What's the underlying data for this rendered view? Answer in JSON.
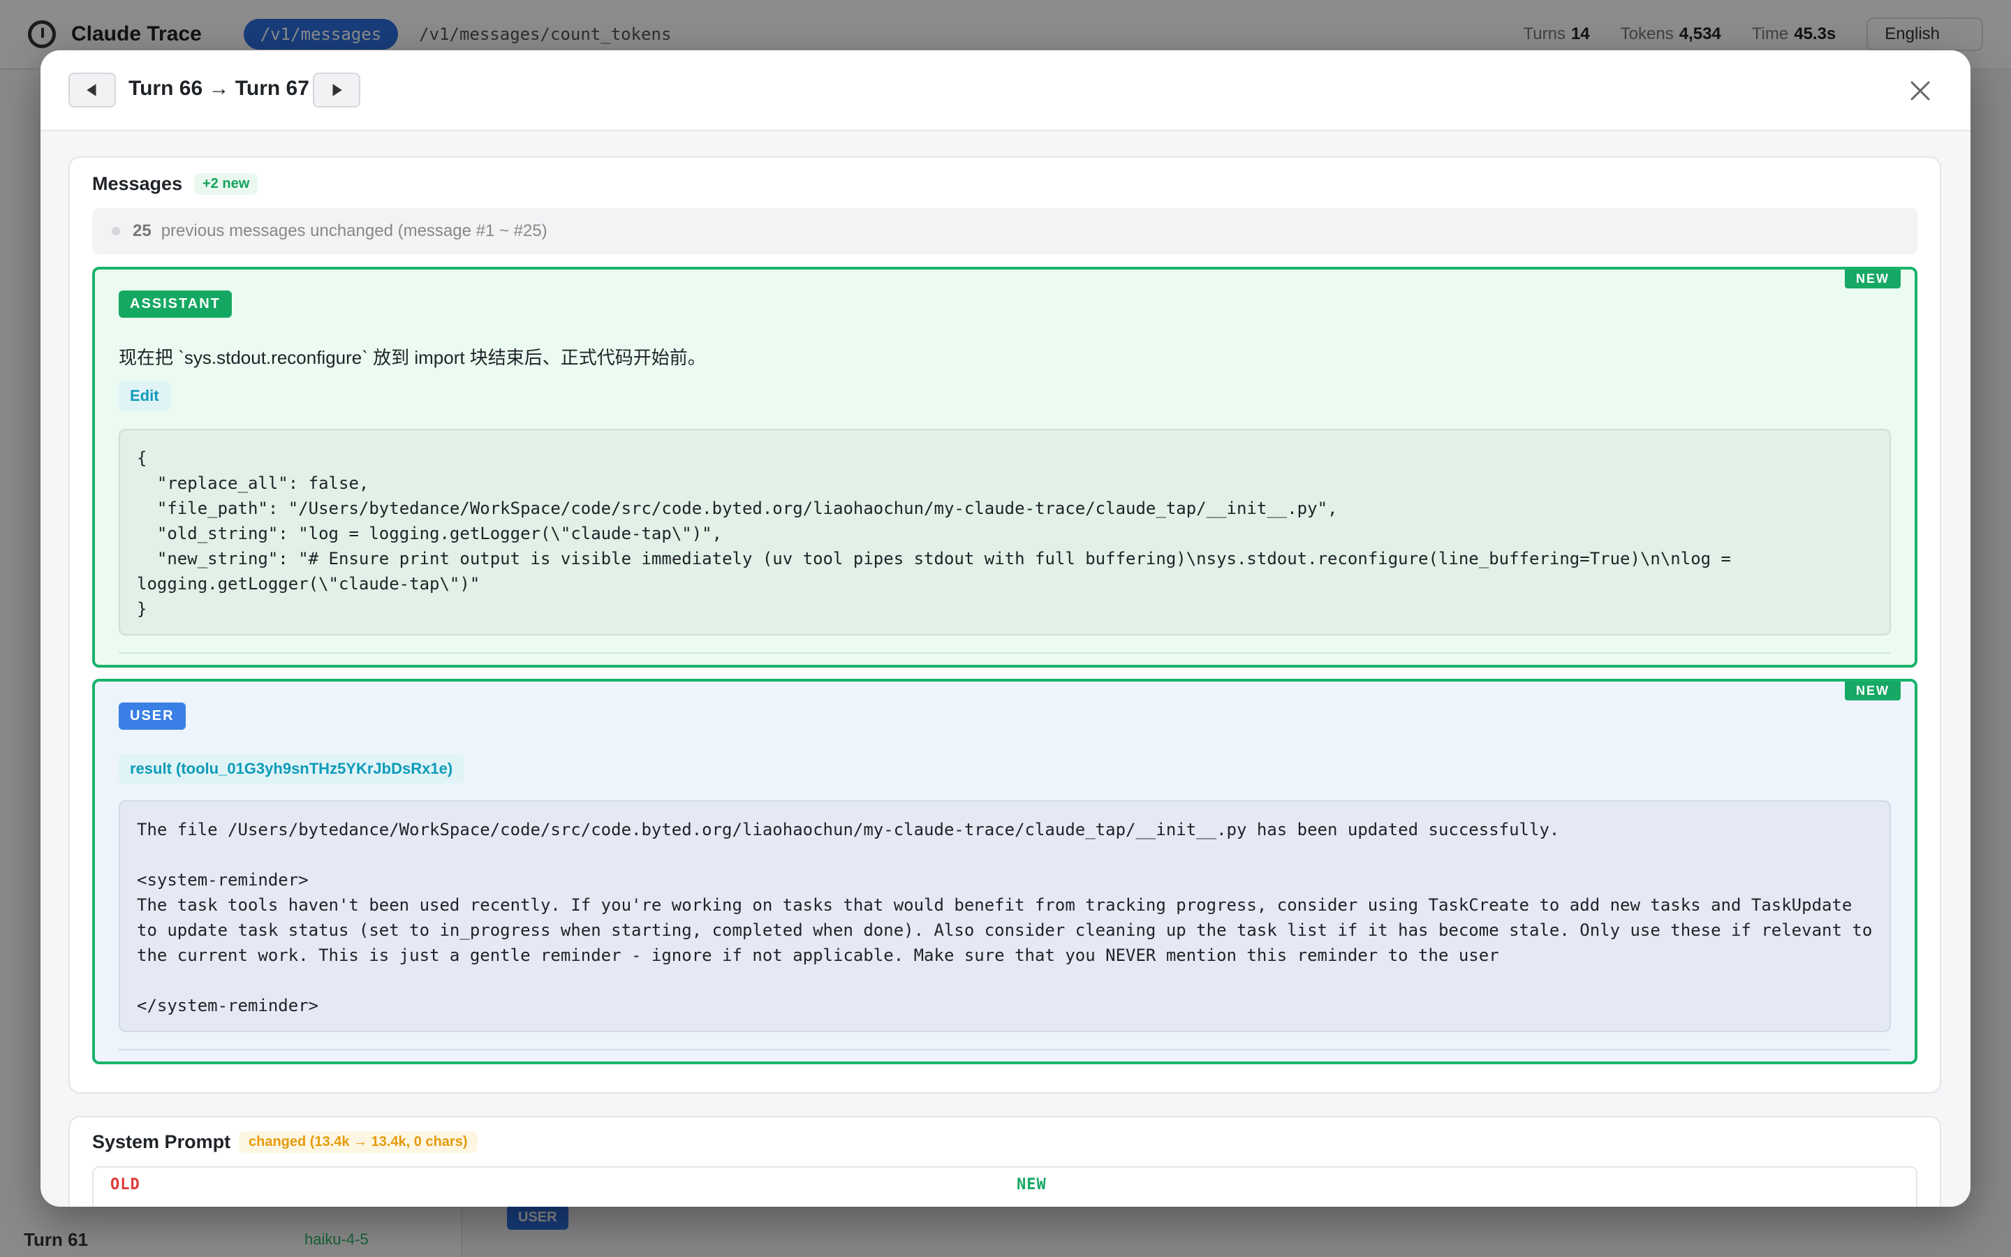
{
  "background": {
    "app_title": "Claude Trace",
    "active_tab": "/v1/messages",
    "tab2": "/v1/messages/count_tokens",
    "stats": {
      "turns_label": "Turns",
      "turns_value": "14",
      "tokens_label": "Tokens",
      "tokens_value": "4,534",
      "time_label": "Time",
      "time_value": "45.3s"
    },
    "language": "English",
    "sidebar_last_item": "Turn 61",
    "sidebar_last_model": "haiku-4-5",
    "bottom_badge": "USER"
  },
  "modal": {
    "title": "Turn 66 → Turn 67",
    "messages": {
      "title": "Messages",
      "new_count": "+2 new",
      "unchanged_count": "25",
      "unchanged_text": "previous messages unchanged (message #1 ~ #25)",
      "items": [
        {
          "role": "ASSISTANT",
          "badge": "NEW",
          "text": "现在把 `sys.stdout.reconfigure` 放到 import 块结束后、正式代码开始前。",
          "tool_label": "Edit",
          "code": "{\n  \"replace_all\": false,\n  \"file_path\": \"/Users/bytedance/WorkSpace/code/src/code.byted.org/liaohaochun/my-claude-trace/claude_tap/__init__.py\",\n  \"old_string\": \"log = logging.getLogger(\\\"claude-tap\\\")\",\n  \"new_string\": \"# Ensure print output is visible immediately (uv tool pipes stdout with full buffering)\\nsys.stdout.reconfigure(line_buffering=True)\\n\\nlog =\nlogging.getLogger(\\\"claude-tap\\\")\"\n}"
        },
        {
          "role": "USER",
          "badge": "NEW",
          "tool_label": "result (toolu_01G3yh9snTHz5YKrJbDsRx1e)",
          "code": "The file /Users/bytedance/WorkSpace/code/src/code.byted.org/liaohaochun/my-claude-trace/claude_tap/__init__.py has been updated successfully.\n\n<system-reminder>\nThe task tools haven't been used recently. If you're working on tasks that would benefit from tracking progress, consider using TaskCreate to add new tasks and TaskUpdate to update task status (set to in_progress when starting, completed when done). Also consider cleaning up the task list if it has become stale. Only use these if relevant to the current work. This is just a gentle reminder - ignore if not applicable. Make sure that you NEVER mention this reminder to the user\n\n</system-reminder>"
        }
      ]
    },
    "system_prompt": {
      "title": "System Prompt",
      "change_badge": "changed (13.4k → 13.4k, 0 chars)",
      "old_label": "OLD",
      "new_label": "NEW"
    }
  },
  "colors": {
    "accent_green": "#19b36b",
    "user_blue": "#3a7fe6",
    "changed_orange": "#e49b0c",
    "old_red": "#e03a3a"
  },
  "icons": [
    "arrow-left-icon",
    "arrow-right-icon",
    "close-icon",
    "clock-icon"
  ]
}
